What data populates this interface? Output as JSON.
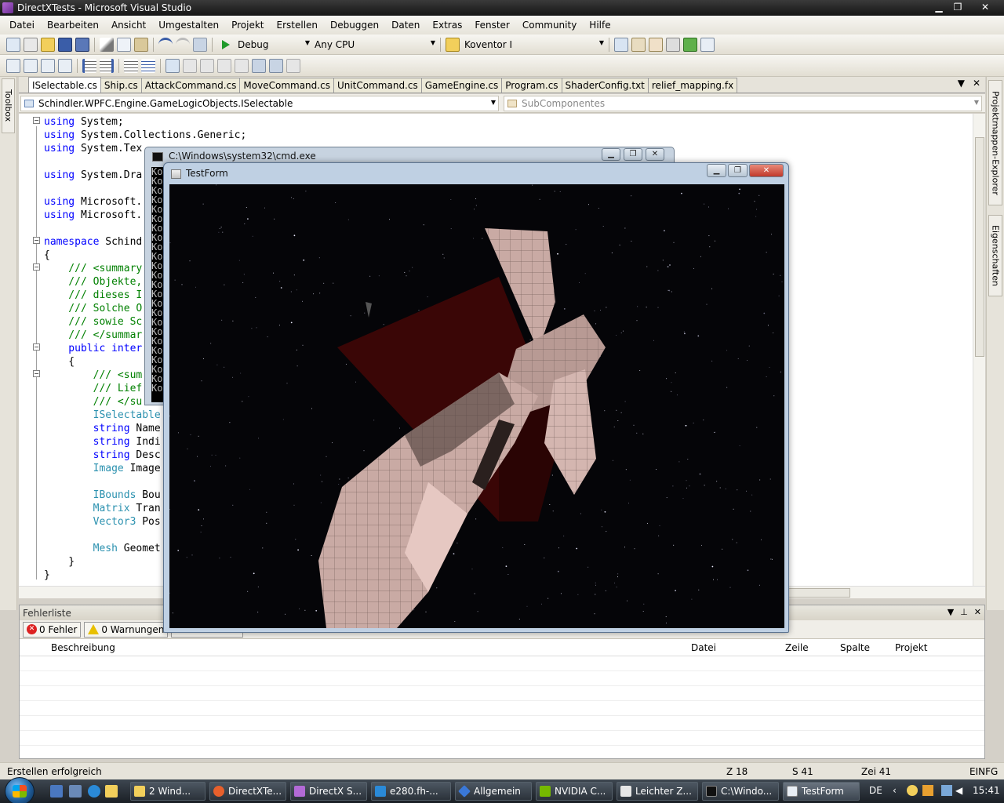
{
  "window": {
    "title": "DirectXTests - Microsoft Visual Studio",
    "controls": [
      "▁",
      "❐",
      "✕"
    ]
  },
  "menu": [
    "Datei",
    "Bearbeiten",
    "Ansicht",
    "Umgestalten",
    "Projekt",
    "Erstellen",
    "Debuggen",
    "Daten",
    "Extras",
    "Fenster",
    "Community",
    "Hilfe"
  ],
  "toolbar": {
    "configuration": "Debug",
    "platform": "Any CPU",
    "find_combo": "Koventor I"
  },
  "toolbox_label": "Toolbox",
  "right_rail": [
    "Projektmappen-Explorer",
    "Eigenschaften"
  ],
  "doc_tabs": [
    "ISelectable.cs",
    "Ship.cs",
    "AttackCommand.cs",
    "MoveCommand.cs",
    "UnitCommand.cs",
    "GameEngine.cs",
    "Program.cs",
    "ShaderConfig.txt",
    "relief_mapping.fx"
  ],
  "active_tab": "ISelectable.cs",
  "tab_controls": [
    "▼",
    "✕"
  ],
  "nav": {
    "type_combo": "Schindler.WPFC.Engine.GameLogicObjects.ISelectable",
    "member_combo": "SubComponentes"
  },
  "code_lines": [
    {
      "t": [
        {
          "c": "kw",
          "s": "using"
        },
        {
          "c": "",
          "s": " System;"
        }
      ]
    },
    {
      "t": [
        {
          "c": "kw",
          "s": "using"
        },
        {
          "c": "",
          "s": " System.Collections.Generic;"
        }
      ]
    },
    {
      "t": [
        {
          "c": "kw",
          "s": "using"
        },
        {
          "c": "",
          "s": " System.Tex"
        }
      ]
    },
    {
      "t": []
    },
    {
      "t": [
        {
          "c": "kw",
          "s": "using"
        },
        {
          "c": "",
          "s": " System.Dra"
        }
      ]
    },
    {
      "t": []
    },
    {
      "t": [
        {
          "c": "kw",
          "s": "using"
        },
        {
          "c": "",
          "s": " Microsoft."
        }
      ]
    },
    {
      "t": [
        {
          "c": "kw",
          "s": "using"
        },
        {
          "c": "",
          "s": " Microsoft."
        }
      ]
    },
    {
      "t": []
    },
    {
      "t": [
        {
          "c": "kw",
          "s": "namespace"
        },
        {
          "c": "",
          "s": " Schind"
        }
      ]
    },
    {
      "t": [
        {
          "c": "",
          "s": "{"
        }
      ]
    },
    {
      "t": [
        {
          "c": "cm",
          "s": "    /// <summary"
        }
      ]
    },
    {
      "t": [
        {
          "c": "cm",
          "s": "    /// Objekte,"
        }
      ]
    },
    {
      "t": [
        {
          "c": "cm",
          "s": "    /// dieses I"
        }
      ]
    },
    {
      "t": [
        {
          "c": "cm",
          "s": "    /// Solche O"
        }
      ]
    },
    {
      "t": [
        {
          "c": "cm",
          "s": "    /// sowie Sc"
        }
      ]
    },
    {
      "t": [
        {
          "c": "cm",
          "s": "    /// </summar"
        }
      ]
    },
    {
      "t": [
        {
          "c": "kw",
          "s": "    public inter"
        }
      ]
    },
    {
      "t": [
        {
          "c": "",
          "s": "    {"
        }
      ]
    },
    {
      "t": [
        {
          "c": "cm",
          "s": "        /// <sum"
        }
      ]
    },
    {
      "t": [
        {
          "c": "cm",
          "s": "        /// Lief"
        }
      ]
    },
    {
      "t": [
        {
          "c": "cm",
          "s": "        /// </su"
        }
      ]
    },
    {
      "t": [
        {
          "c": "ty",
          "s": "        ISelectable"
        }
      ]
    },
    {
      "t": [
        {
          "c": "kw",
          "s": "        string"
        },
        {
          "c": "",
          "s": " Name"
        }
      ]
    },
    {
      "t": [
        {
          "c": "kw",
          "s": "        string"
        },
        {
          "c": "",
          "s": " Indi"
        }
      ]
    },
    {
      "t": [
        {
          "c": "kw",
          "s": "        string"
        },
        {
          "c": "",
          "s": " Desc"
        }
      ]
    },
    {
      "t": [
        {
          "c": "ty",
          "s": "        Image"
        },
        {
          "c": "",
          "s": " Image"
        }
      ]
    },
    {
      "t": []
    },
    {
      "t": [
        {
          "c": "ty",
          "s": "        IBounds"
        },
        {
          "c": "",
          "s": " Bou"
        }
      ]
    },
    {
      "t": [
        {
          "c": "ty",
          "s": "        Matrix"
        },
        {
          "c": "",
          "s": " Tran"
        }
      ]
    },
    {
      "t": [
        {
          "c": "ty",
          "s": "        Vector3"
        },
        {
          "c": "",
          "s": " Pos"
        }
      ]
    },
    {
      "t": []
    },
    {
      "t": [
        {
          "c": "ty",
          "s": "        Mesh"
        },
        {
          "c": "",
          "s": " Geomet"
        }
      ]
    },
    {
      "t": [
        {
          "c": "",
          "s": "    }"
        }
      ]
    },
    {
      "t": [
        {
          "c": "",
          "s": "}"
        }
      ]
    }
  ],
  "errorlist": {
    "title": "Fehlerliste",
    "errors_label": "0 Fehler",
    "warnings_label": "0 Warnungen",
    "columns": [
      "Beschreibung",
      "Datei",
      "Zeile",
      "Spalte",
      "Projekt"
    ]
  },
  "status": {
    "message": "Erstellen erfolgreich",
    "line": "Z 18",
    "column": "S 41",
    "char": "Zei 41",
    "mode": "EINFG"
  },
  "cmd": {
    "title": "C:\\Windows\\system32\\cmd.exe",
    "line_prefix": "Ko",
    "line_count": 24
  },
  "testform": {
    "title": "TestForm"
  },
  "taskbar": {
    "items": [
      "2 Wind...",
      "DirectXTe...",
      "DirectX S...",
      "e280.fh-...",
      "Allgemein",
      "NVIDIA C...",
      "Leichter Z...",
      "C:\\Windo...",
      "TestForm"
    ],
    "active": "TestForm",
    "language": "DE",
    "clock": "15:41"
  },
  "colors": {
    "keyword": "#0000ff",
    "comment": "#008000",
    "type": "#2b91af",
    "ship_hull": "#c9aaa4",
    "red_panel": "#3a0606"
  }
}
